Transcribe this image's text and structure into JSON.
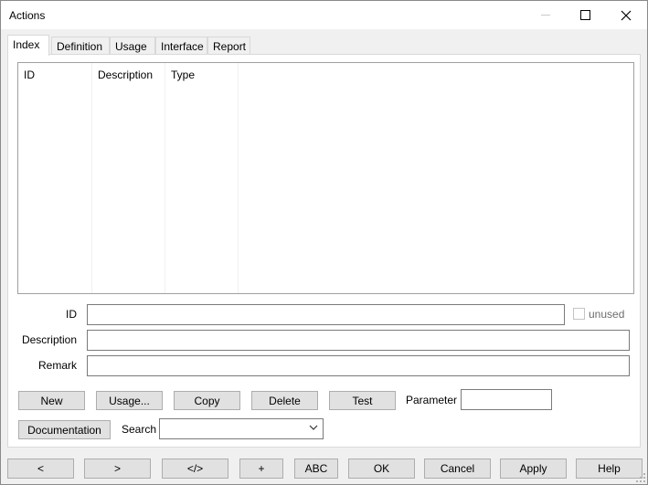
{
  "window": {
    "title": "Actions"
  },
  "tabs": [
    "Index",
    "Definition",
    "Usage",
    "Interface",
    "Report"
  ],
  "list": {
    "columns": [
      "ID",
      "Description",
      "Type"
    ]
  },
  "form": {
    "id_label": "ID",
    "id_value": "",
    "unused_label": "unused",
    "unused_checked": false,
    "description_label": "Description",
    "description_value": "",
    "remark_label": "Remark",
    "remark_value": "",
    "parameter_label": "Parameter",
    "parameter_value": "",
    "search_label": "Search",
    "search_value": ""
  },
  "buttons": {
    "new": "New",
    "usage": "Usage...",
    "copy": "Copy",
    "delete": "Delete",
    "test": "Test",
    "documentation": "Documentation"
  },
  "bottom_buttons": {
    "prev": "<",
    "next": ">",
    "code": "</>",
    "plus": "+",
    "abc": "ABC",
    "ok": "OK",
    "cancel": "Cancel",
    "apply": "Apply",
    "help": "Help"
  }
}
